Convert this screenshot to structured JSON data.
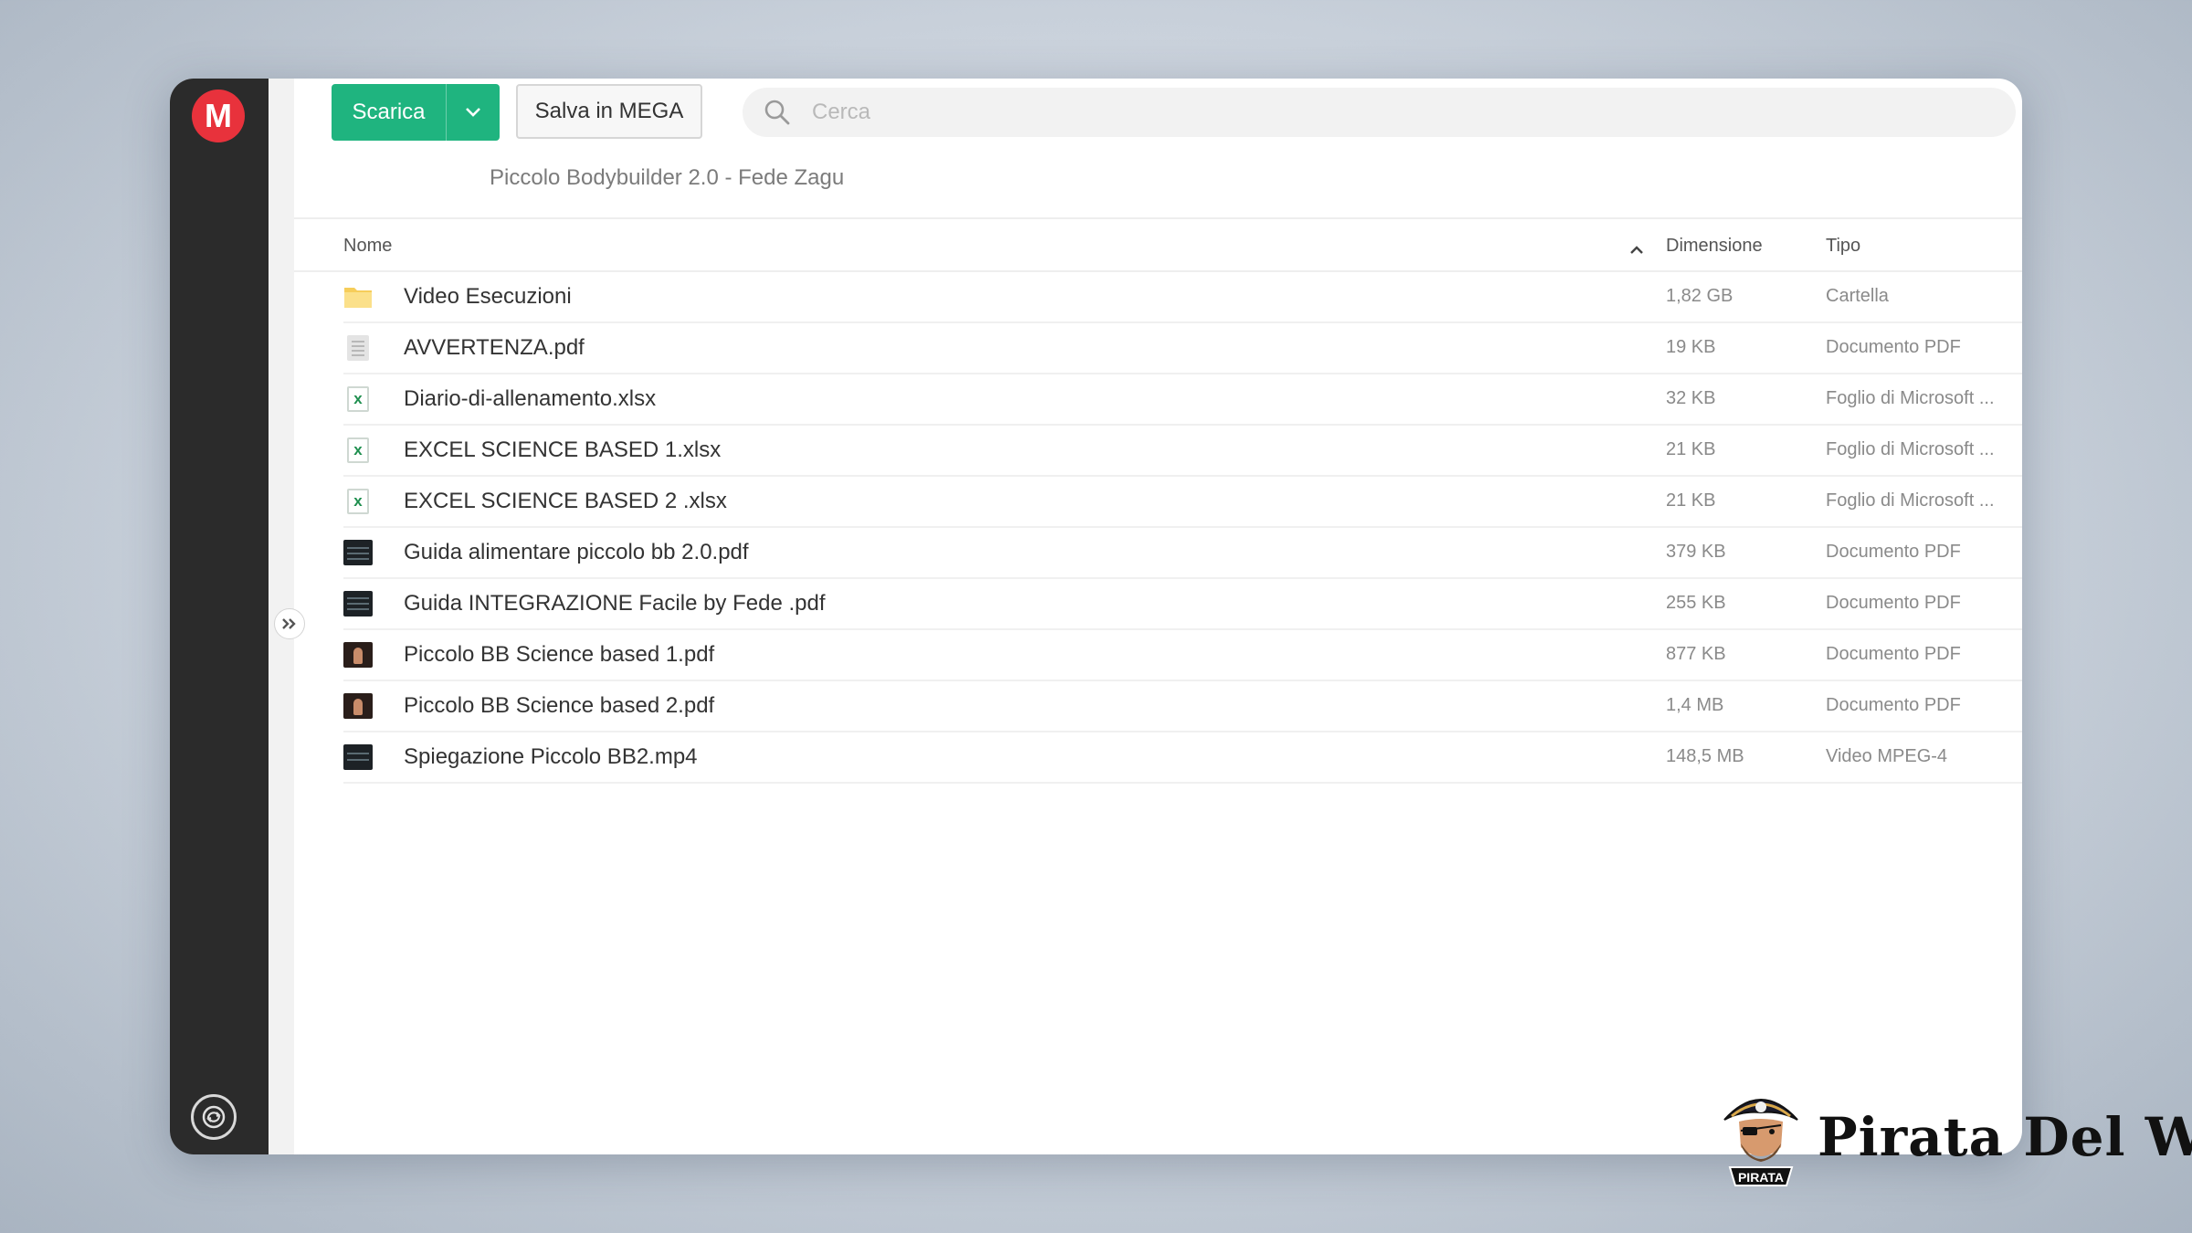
{
  "toolbar": {
    "download_label": "Scarica",
    "save_label": "Salva in MEGA"
  },
  "search": {
    "placeholder": "Cerca"
  },
  "breadcrumb": "Piccolo Bodybuilder 2.0 - Fede Zagu",
  "sidebar": {
    "logo_letter": "M"
  },
  "table": {
    "headers": {
      "name": "Nome",
      "size": "Dimensione",
      "type": "Tipo"
    },
    "rows": [
      {
        "name": "Video Esecuzioni",
        "size": "1,82 GB",
        "type": "Cartella",
        "icon": "folder-icon"
      },
      {
        "name": "AVVERTENZA.pdf",
        "size": "19 KB",
        "type": "Documento PDF",
        "icon": "pdf-file-icon"
      },
      {
        "name": "Diario-di-allenamento.xlsx",
        "size": "32 KB",
        "type": "Foglio di Microsoft ...",
        "icon": "excel-file-icon"
      },
      {
        "name": "EXCEL SCIENCE BASED 1.xlsx",
        "size": "21 KB",
        "type": "Foglio di Microsoft ...",
        "icon": "excel-file-icon"
      },
      {
        "name": "EXCEL SCIENCE BASED 2 .xlsx",
        "size": "21 KB",
        "type": "Foglio di Microsoft ...",
        "icon": "excel-file-icon"
      },
      {
        "name": "Guida alimentare piccolo bb 2.0.pdf",
        "size": "379 KB",
        "type": "Documento PDF",
        "icon": "pdf-thumbnail-icon"
      },
      {
        "name": "Guida INTEGRAZIONE Facile by Fede .pdf",
        "size": "255 KB",
        "type": "Documento PDF",
        "icon": "pdf-thumbnail-icon"
      },
      {
        "name": "Piccolo BB Science based 1.pdf",
        "size": "877 KB",
        "type": "Documento PDF",
        "icon": "photo-thumbnail-icon"
      },
      {
        "name": "Piccolo BB Science based 2.pdf",
        "size": "1,4 MB",
        "type": "Documento PDF",
        "icon": "photo-thumbnail-icon"
      },
      {
        "name": "Spiegazione Piccolo BB2.mp4",
        "size": "148,5 MB",
        "type": "Video MPEG-4",
        "icon": "video-thumbnail-icon"
      }
    ]
  },
  "brand": {
    "badge_text": "PIRATA",
    "name": "Pirata Del Web"
  },
  "colors": {
    "accent_green": "#1fb47f",
    "mega_red": "#e8323c",
    "sidebar_dark": "#2b2b2b"
  }
}
